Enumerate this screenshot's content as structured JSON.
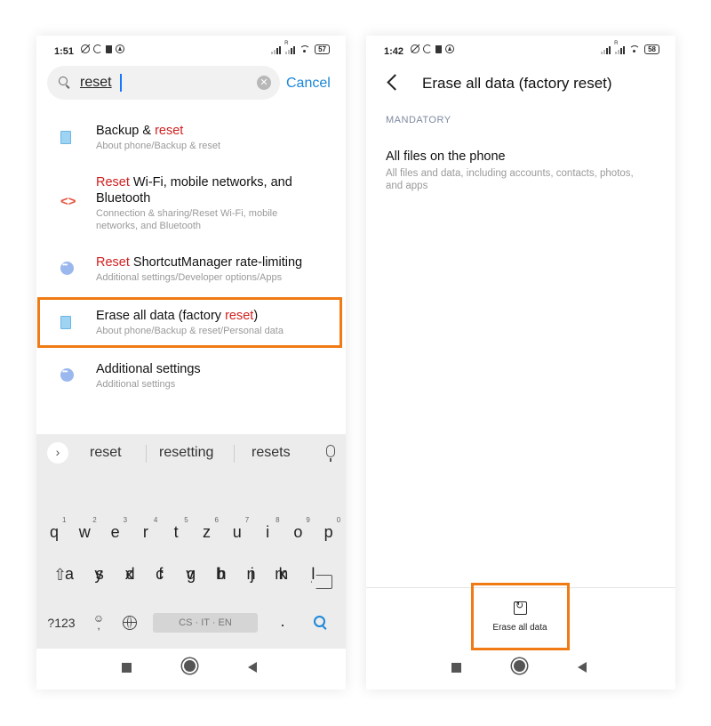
{
  "colors": {
    "accent_orange": "#f07a14",
    "highlight_red": "#d11f1f",
    "link_blue": "#1b86d8"
  },
  "left": {
    "status": {
      "time": "1:51",
      "battery": "57"
    },
    "search": {
      "query": "reset",
      "cancel": "Cancel"
    },
    "results": [
      {
        "title_pre": "Backup & ",
        "title_hl": "reset",
        "title_post": "",
        "subtitle": "About phone/Backup & reset",
        "icon": "phone-icon"
      },
      {
        "title_pre": "",
        "title_hl": "Reset",
        "title_post": " Wi-Fi, mobile networks, and Bluetooth",
        "subtitle": "Connection & sharing/Reset Wi-Fi, mobile networks, and Bluetooth",
        "icon": "connection-icon"
      },
      {
        "title_pre": "",
        "title_hl": "Reset",
        "title_post": " ShortcutManager rate-limiting",
        "subtitle": "Additional settings/Developer options/Apps",
        "icon": "more-icon"
      },
      {
        "title_pre": "Erase all data (factory ",
        "title_hl": "reset",
        "title_post": ")",
        "subtitle": "About phone/Backup & reset/Personal data",
        "icon": "phone-icon"
      },
      {
        "title_pre": "Additional settings",
        "title_hl": "",
        "title_post": "",
        "subtitle": "Additional settings",
        "icon": "more-icon"
      }
    ],
    "keyboard": {
      "suggestions": [
        "reset",
        "resetting",
        "resets"
      ],
      "row1": [
        "q",
        "w",
        "e",
        "r",
        "t",
        "z",
        "u",
        "i",
        "o",
        "p"
      ],
      "row1_nums": [
        "1",
        "2",
        "3",
        "4",
        "5",
        "6",
        "7",
        "8",
        "9",
        "0"
      ],
      "row2": [
        "a",
        "s",
        "d",
        "f",
        "g",
        "h",
        "j",
        "k",
        "l"
      ],
      "row3": [
        "y",
        "x",
        "c",
        "v",
        "b",
        "n",
        "m"
      ],
      "symbols_key": "?123",
      "emoji_key": "☺",
      "comma_key": ",",
      "period_key": ".",
      "space_label": "CS · IT · EN"
    }
  },
  "right": {
    "status": {
      "time": "1:42",
      "battery": "58"
    },
    "title": "Erase all data (factory reset)",
    "section": "MANDATORY",
    "item_title": "All files on the phone",
    "item_subtitle": "All files and data, including accounts, contacts, photos, and apps",
    "erase_label": "Erase all data"
  }
}
